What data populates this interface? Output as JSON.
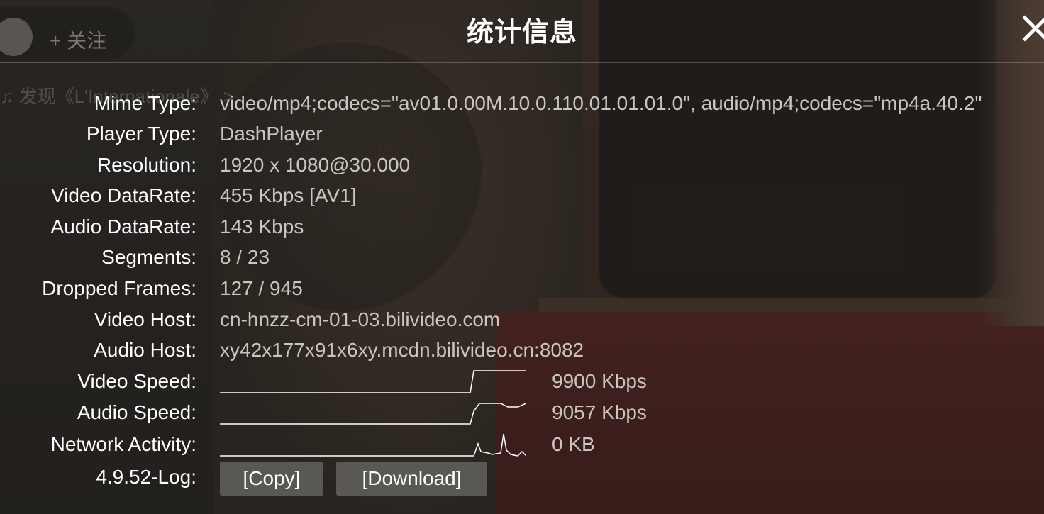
{
  "player_chrome": {
    "follow_label": "+ 关注",
    "music_link": "♫ 发现《L'Internationale》 >"
  },
  "panel": {
    "title": "统计信息",
    "close_icon": "close-icon"
  },
  "stats": {
    "mime_type": {
      "label": "Mime Type:",
      "value": "video/mp4;codecs=\"av01.0.00M.10.0.110.01.01.01.0\", audio/mp4;codecs=\"mp4a.40.2\""
    },
    "player_type": {
      "label": "Player Type:",
      "value": "DashPlayer"
    },
    "resolution": {
      "label": "Resolution:",
      "value": "1920 x 1080@30.000"
    },
    "video_datarate": {
      "label": "Video DataRate:",
      "value": "455 Kbps [AV1]"
    },
    "audio_datarate": {
      "label": "Audio DataRate:",
      "value": "143 Kbps"
    },
    "segments": {
      "label": "Segments:",
      "value": "8 / 23"
    },
    "dropped_frames": {
      "label": "Dropped Frames:",
      "value": "127 / 945"
    },
    "video_host": {
      "label": "Video Host:",
      "value": "cn-hnzz-cm-01-03.bilivideo.com"
    },
    "audio_host": {
      "label": "Audio Host:",
      "value": "xy42x177x91x6xy.mcdn.bilivideo.cn:8082"
    },
    "video_speed": {
      "label": "Video Speed:",
      "value": "9900 Kbps"
    },
    "audio_speed": {
      "label": "Audio Speed:",
      "value": "9057 Kbps"
    },
    "network_activity": {
      "label": "Network Activity:",
      "value": "0 KB"
    },
    "log": {
      "label": "4.9.52-Log:",
      "copy_label": "[Copy]",
      "download_label": "[Download]"
    }
  },
  "colors": {
    "label_text": "#ffffff",
    "value_text": "#c9c5c0",
    "button_bg": "#5a5855",
    "graph_line": "#ffffff"
  }
}
